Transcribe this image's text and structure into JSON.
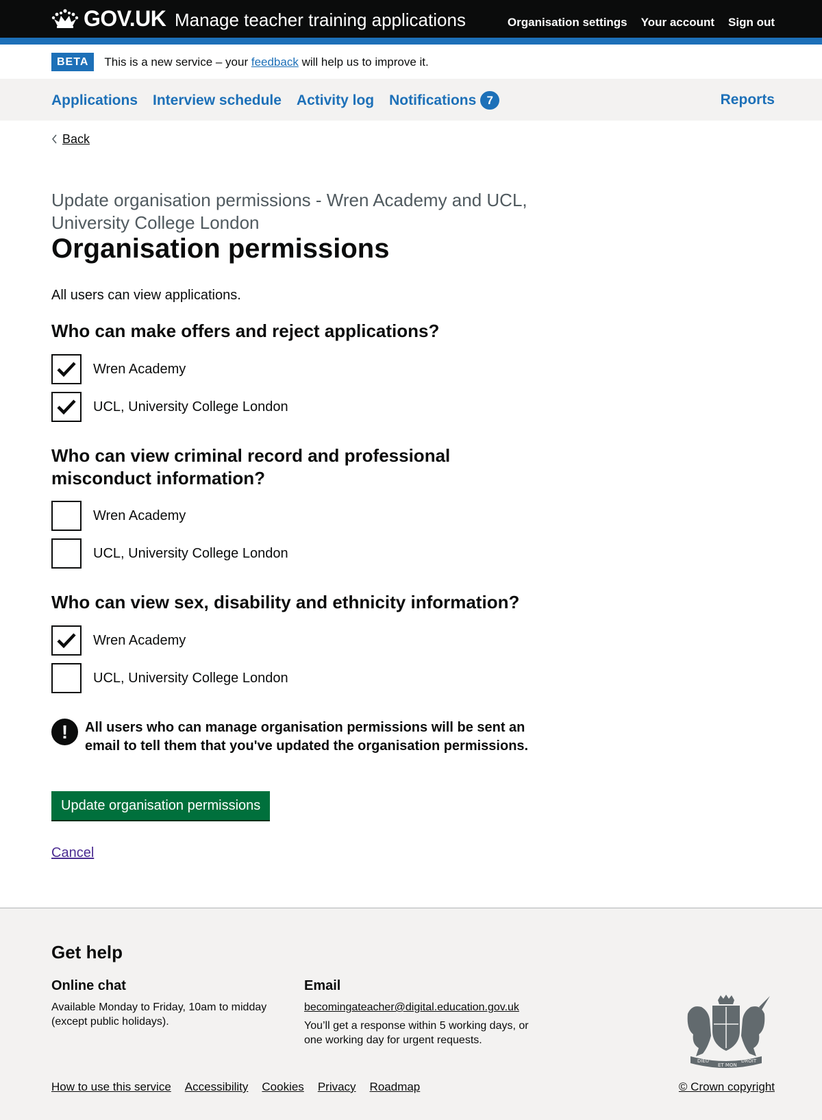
{
  "header": {
    "logo_text": "GOV.UK",
    "service_name": "Manage teacher training applications",
    "nav": [
      "Organisation settings",
      "Your account",
      "Sign out"
    ]
  },
  "phase_banner": {
    "tag": "BETA",
    "text_before": "This is a new service – your ",
    "link": "feedback",
    "text_after": " will help us to improve it."
  },
  "primary_nav": {
    "items": [
      "Applications",
      "Interview schedule",
      "Activity log",
      "Notifications"
    ],
    "notifications_count": "7",
    "reports": "Reports"
  },
  "back_link": "Back",
  "caption": "Update organisation permissions - Wren Academy and UCL, University College London",
  "title": "Organisation permissions",
  "intro": "All users can view applications.",
  "questions": [
    {
      "heading": "Who can make offers and reject applications?",
      "options": [
        {
          "label": "Wren Academy",
          "checked": true
        },
        {
          "label": "UCL, University College London",
          "checked": true
        }
      ]
    },
    {
      "heading": "Who can view criminal record and professional misconduct information?",
      "options": [
        {
          "label": "Wren Academy",
          "checked": false
        },
        {
          "label": "UCL, University College London",
          "checked": false
        }
      ]
    },
    {
      "heading": "Who can view sex, disability and ethnicity information?",
      "options": [
        {
          "label": "Wren Academy",
          "checked": true
        },
        {
          "label": "UCL, University College London",
          "checked": false
        }
      ]
    }
  ],
  "warning": {
    "icon": "!",
    "text": "All users who can manage organisation permissions will be sent an email to tell them that you've updated the organisation permissions."
  },
  "submit_button": "Update organisation permissions",
  "cancel_link": "Cancel",
  "footer": {
    "title": "Get help",
    "chat_heading": "Online chat",
    "chat_text": "Available Monday to Friday, 10am to midday (except public holidays).",
    "email_heading": "Email",
    "email_address": "becomingateacher@digital.education.gov.uk",
    "email_text": "You’ll get a response within 5 working days, or one working day for urgent requests.",
    "links": [
      "How to use this service",
      "Accessibility",
      "Cookies",
      "Privacy",
      "Roadmap"
    ],
    "copyright": "© Crown copyright",
    "crest_motto_left": "DIEU",
    "crest_motto_right": "DROIT",
    "crest_motto_center": "ET MON"
  },
  "colors": {
    "header_bg": "#0b0c0c",
    "brand_blue": "#1d70b8",
    "button_green": "#00703c",
    "visited_link": "#4c2c92",
    "footer_bg": "#f3f2f1"
  }
}
